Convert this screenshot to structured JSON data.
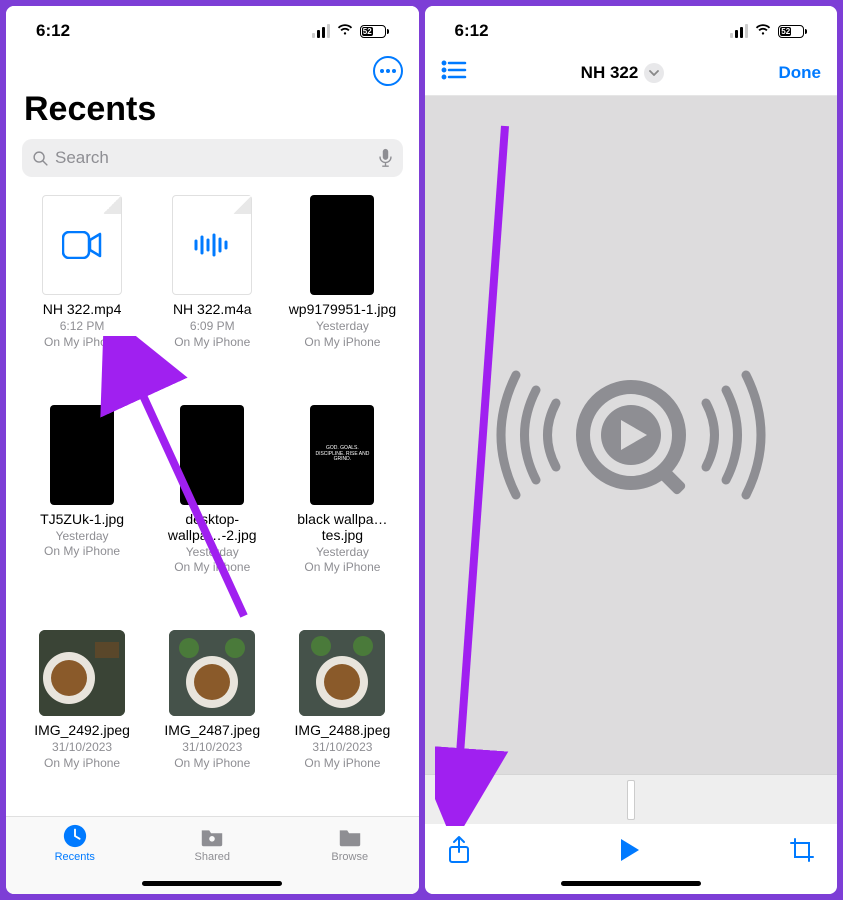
{
  "status": {
    "time": "6:12",
    "battery": "52"
  },
  "left": {
    "title": "Recents",
    "search_placeholder": "Search",
    "files": [
      {
        "name": "NH 322.mp4",
        "line1": "6:12 PM",
        "line2": "On My iPhone"
      },
      {
        "name": "NH 322.m4a",
        "line1": "6:09 PM",
        "line2": "On My iPhone"
      },
      {
        "name": "wp9179951-1.jpg",
        "line1": "Yesterday",
        "line2": "On My iPhone"
      },
      {
        "name": "TJ5ZUk-1.jpg",
        "line1": "Yesterday",
        "line2": "On My iPhone"
      },
      {
        "name": "desktop-wallpa…-2.jpg",
        "line1": "Yesterday",
        "line2": "On My iPhone"
      },
      {
        "name": "black wallpa…tes.jpg",
        "line1": "Yesterday",
        "line2": "On My iPhone"
      },
      {
        "name": "IMG_2492.jpeg",
        "line1": "31/10/2023",
        "line2": "On My iPhone"
      },
      {
        "name": "IMG_2487.jpeg",
        "line1": "31/10/2023",
        "line2": "On My iPhone"
      },
      {
        "name": "IMG_2488.jpeg",
        "line1": "31/10/2023",
        "line2": "On My iPhone"
      }
    ],
    "tabs": {
      "recents": "Recents",
      "shared": "Shared",
      "browse": "Browse"
    }
  },
  "right": {
    "title": "NH 322",
    "done": "Done"
  },
  "thumb_text": {
    "f2": "",
    "f5": "GOD. GOALS. DISCIPLINE. RISE AND GRIND."
  }
}
